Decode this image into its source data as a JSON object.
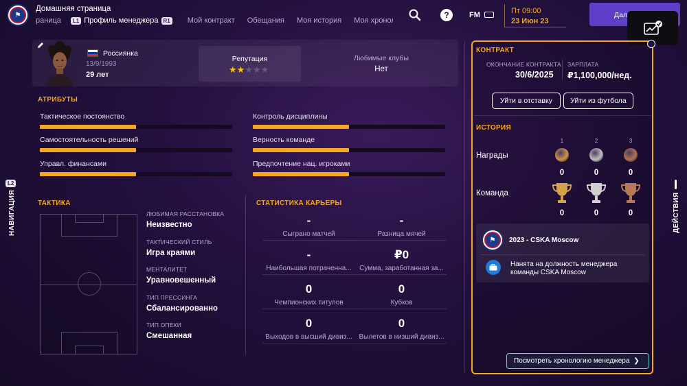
{
  "header": {
    "home_title": "Домашняя страница",
    "tabs": [
      {
        "label": "раница",
        "key": ""
      },
      {
        "label": "Профиль менеджера",
        "key": "L1",
        "key_after": "R1"
      },
      {
        "label": "Мой контракт"
      },
      {
        "label": "Обещания"
      },
      {
        "label": "Моя история"
      },
      {
        "label": "Моя хронология"
      }
    ],
    "fm_logo": "FM",
    "date_time": "Пт 09:00",
    "date_day": "23 Июн 23",
    "continue_label": "Дал"
  },
  "profile": {
    "nationality": "Россиянка",
    "dob": "13/9/1993",
    "age": "29 лет",
    "reputation_label": "Репутация",
    "reputation_stars": 2,
    "reputation_max": 5,
    "fav_clubs_label": "Любимые клубы",
    "fav_clubs_value": "Нет"
  },
  "attributes": {
    "title": "АТРИБУТЫ",
    "items": [
      {
        "label": "Тактическое постоянство",
        "level": 0.5
      },
      {
        "label": "Контроль дисциплины",
        "level": 0.5
      },
      {
        "label": "Самостоятельность решений",
        "level": 0.5
      },
      {
        "label": "Верность команде",
        "level": 0.5
      },
      {
        "label": "Управл. финансами",
        "level": 0.5
      },
      {
        "label": "Предпочтение нац. игроками",
        "level": 0.5
      }
    ]
  },
  "tactics": {
    "title": "ТАКТИКА",
    "items": [
      {
        "label": "ЛЮБИМАЯ РАССТАНОВКА",
        "value": "Неизвестно"
      },
      {
        "label": "ТАКТИЧЕСКИЙ СТИЛЬ",
        "value": "Игра краями"
      },
      {
        "label": "МЕНТАЛИТЕТ",
        "value": "Уравновешенный"
      },
      {
        "label": "ТИП ПРЕССИНГА",
        "value": "Сбалансированно"
      },
      {
        "label": "ТИП ОПЕКИ",
        "value": "Смешанная"
      }
    ]
  },
  "career_stats": {
    "title": "СТАТИСТИКА КАРЬЕРЫ",
    "items": [
      {
        "value": "-",
        "label": "Сыграно матчей"
      },
      {
        "value": "-",
        "label": "Разница мячей"
      },
      {
        "value": "-",
        "label": "Наибольшая потраченна..."
      },
      {
        "value": "₽0",
        "label": "Сумма, заработанная за..."
      },
      {
        "value": "0",
        "label": "Чемпионских титулов"
      },
      {
        "value": "0",
        "label": "Кубков"
      },
      {
        "value": "0",
        "label": "Выходов в высший дивиз..."
      },
      {
        "value": "0",
        "label": "Вылетов в низший дивиз..."
      }
    ]
  },
  "contract": {
    "title": "КОНТРАКТ",
    "end_label": "ОКОНЧАНИЕ КОНТРАКТА",
    "end_value": "30/6/2025",
    "salary_label": "ЗАРПЛАТА",
    "salary_value": "₽1,100,000/нед.",
    "resign_label": "Уйти в отставку",
    "retire_label": "Уйти из футбола"
  },
  "history": {
    "title": "ИСТОРИЯ",
    "places": [
      "1",
      "2",
      "3"
    ],
    "awards_label": "Награды",
    "awards_counts": [
      "0",
      "0",
      "0"
    ],
    "team_label": "Команда",
    "team_counts": [
      "0",
      "0",
      "0"
    ],
    "entry_title": "2023 - CSKA Moscow",
    "entry_text": "Нанята на должность менеджера команды CSKA Moscow",
    "timeline_label": "Посмотреть хронологию менеджера"
  },
  "side": {
    "nav_label": "НАВИГАЦИЯ",
    "nav_key": "L2",
    "actions_label": "ДЕЙСТВИЯ"
  },
  "colors": {
    "accent": "#f5a623",
    "continue": "#5e3fc8",
    "timeline_border": "#5fd3d3"
  }
}
